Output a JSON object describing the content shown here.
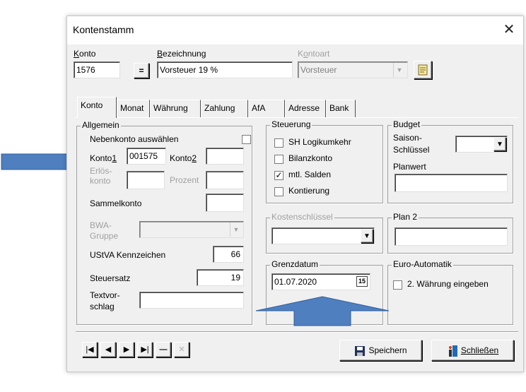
{
  "window": {
    "title": "Kontenstamm",
    "close_glyph": "✕"
  },
  "header": {
    "konto_label": "Konto",
    "konto_value": "1576",
    "equals_label": "=",
    "bezeichnung_label": "Bezeichnung",
    "bezeichnung_value": "Vorsteuer 19 %",
    "kontoart_label": "Kontoart",
    "kontoart_value": "Vorsteuer"
  },
  "tabs": [
    {
      "label": "Konto"
    },
    {
      "label": "Monat"
    },
    {
      "label": "Währung"
    },
    {
      "label": "Zahlung"
    },
    {
      "label": "AfA"
    },
    {
      "label": "Adresse"
    },
    {
      "label": "Bank"
    }
  ],
  "allgemein": {
    "title": "Allgemein",
    "nebenkonto_label": "Nebenkonto auswählen",
    "konto1_label": "Konto1",
    "konto1_value": "001575",
    "konto2_label": "Konto2",
    "konto2_value": "",
    "erloes_label": "Erlös-\nkonto",
    "prozent_label": "Prozent",
    "sammelkonto_label": "Sammelkonto",
    "bwa_label": "BWA-\nGruppe",
    "ustva_label": "UStVA Kennzeichen",
    "ustva_value": "66",
    "steuersatz_label": "Steuersatz",
    "steuersatz_value": "19",
    "textvorschlag_label": "Textvor-\nschlag",
    "textvorschlag_value": ""
  },
  "steuerung": {
    "title": "Steuerung",
    "items": [
      {
        "label": "SH Logikumkehr",
        "checked": false,
        "mark": ""
      },
      {
        "label": "Bilanzkonto",
        "checked": false,
        "mark": ""
      },
      {
        "label": "mtl. Salden",
        "checked": true,
        "mark": "✓"
      },
      {
        "label": "Kontierung",
        "checked": false,
        "mark": ""
      }
    ]
  },
  "budget": {
    "title": "Budget",
    "saison_label": "Saison-\nSchlüssel",
    "planwert_label": "Planwert"
  },
  "kostenschluessel": {
    "title": "Kostenschlüssel"
  },
  "plan2": {
    "title": "Plan 2"
  },
  "grenzdatum": {
    "title": "Grenzdatum",
    "value": "01.07.2020",
    "cal_label": "15"
  },
  "euro": {
    "title": "Euro-Automatik",
    "checkbox_label": "2. Währung eingeben"
  },
  "footer": {
    "nav": [
      "|◀",
      "◀",
      "▶",
      "▶|",
      "—",
      "✕"
    ],
    "save_label": "Speichern",
    "close_label": "Schließen"
  },
  "colors": {
    "annotation_arrow": "#4f7fbf",
    "window_bg": "#f0f0f0"
  }
}
